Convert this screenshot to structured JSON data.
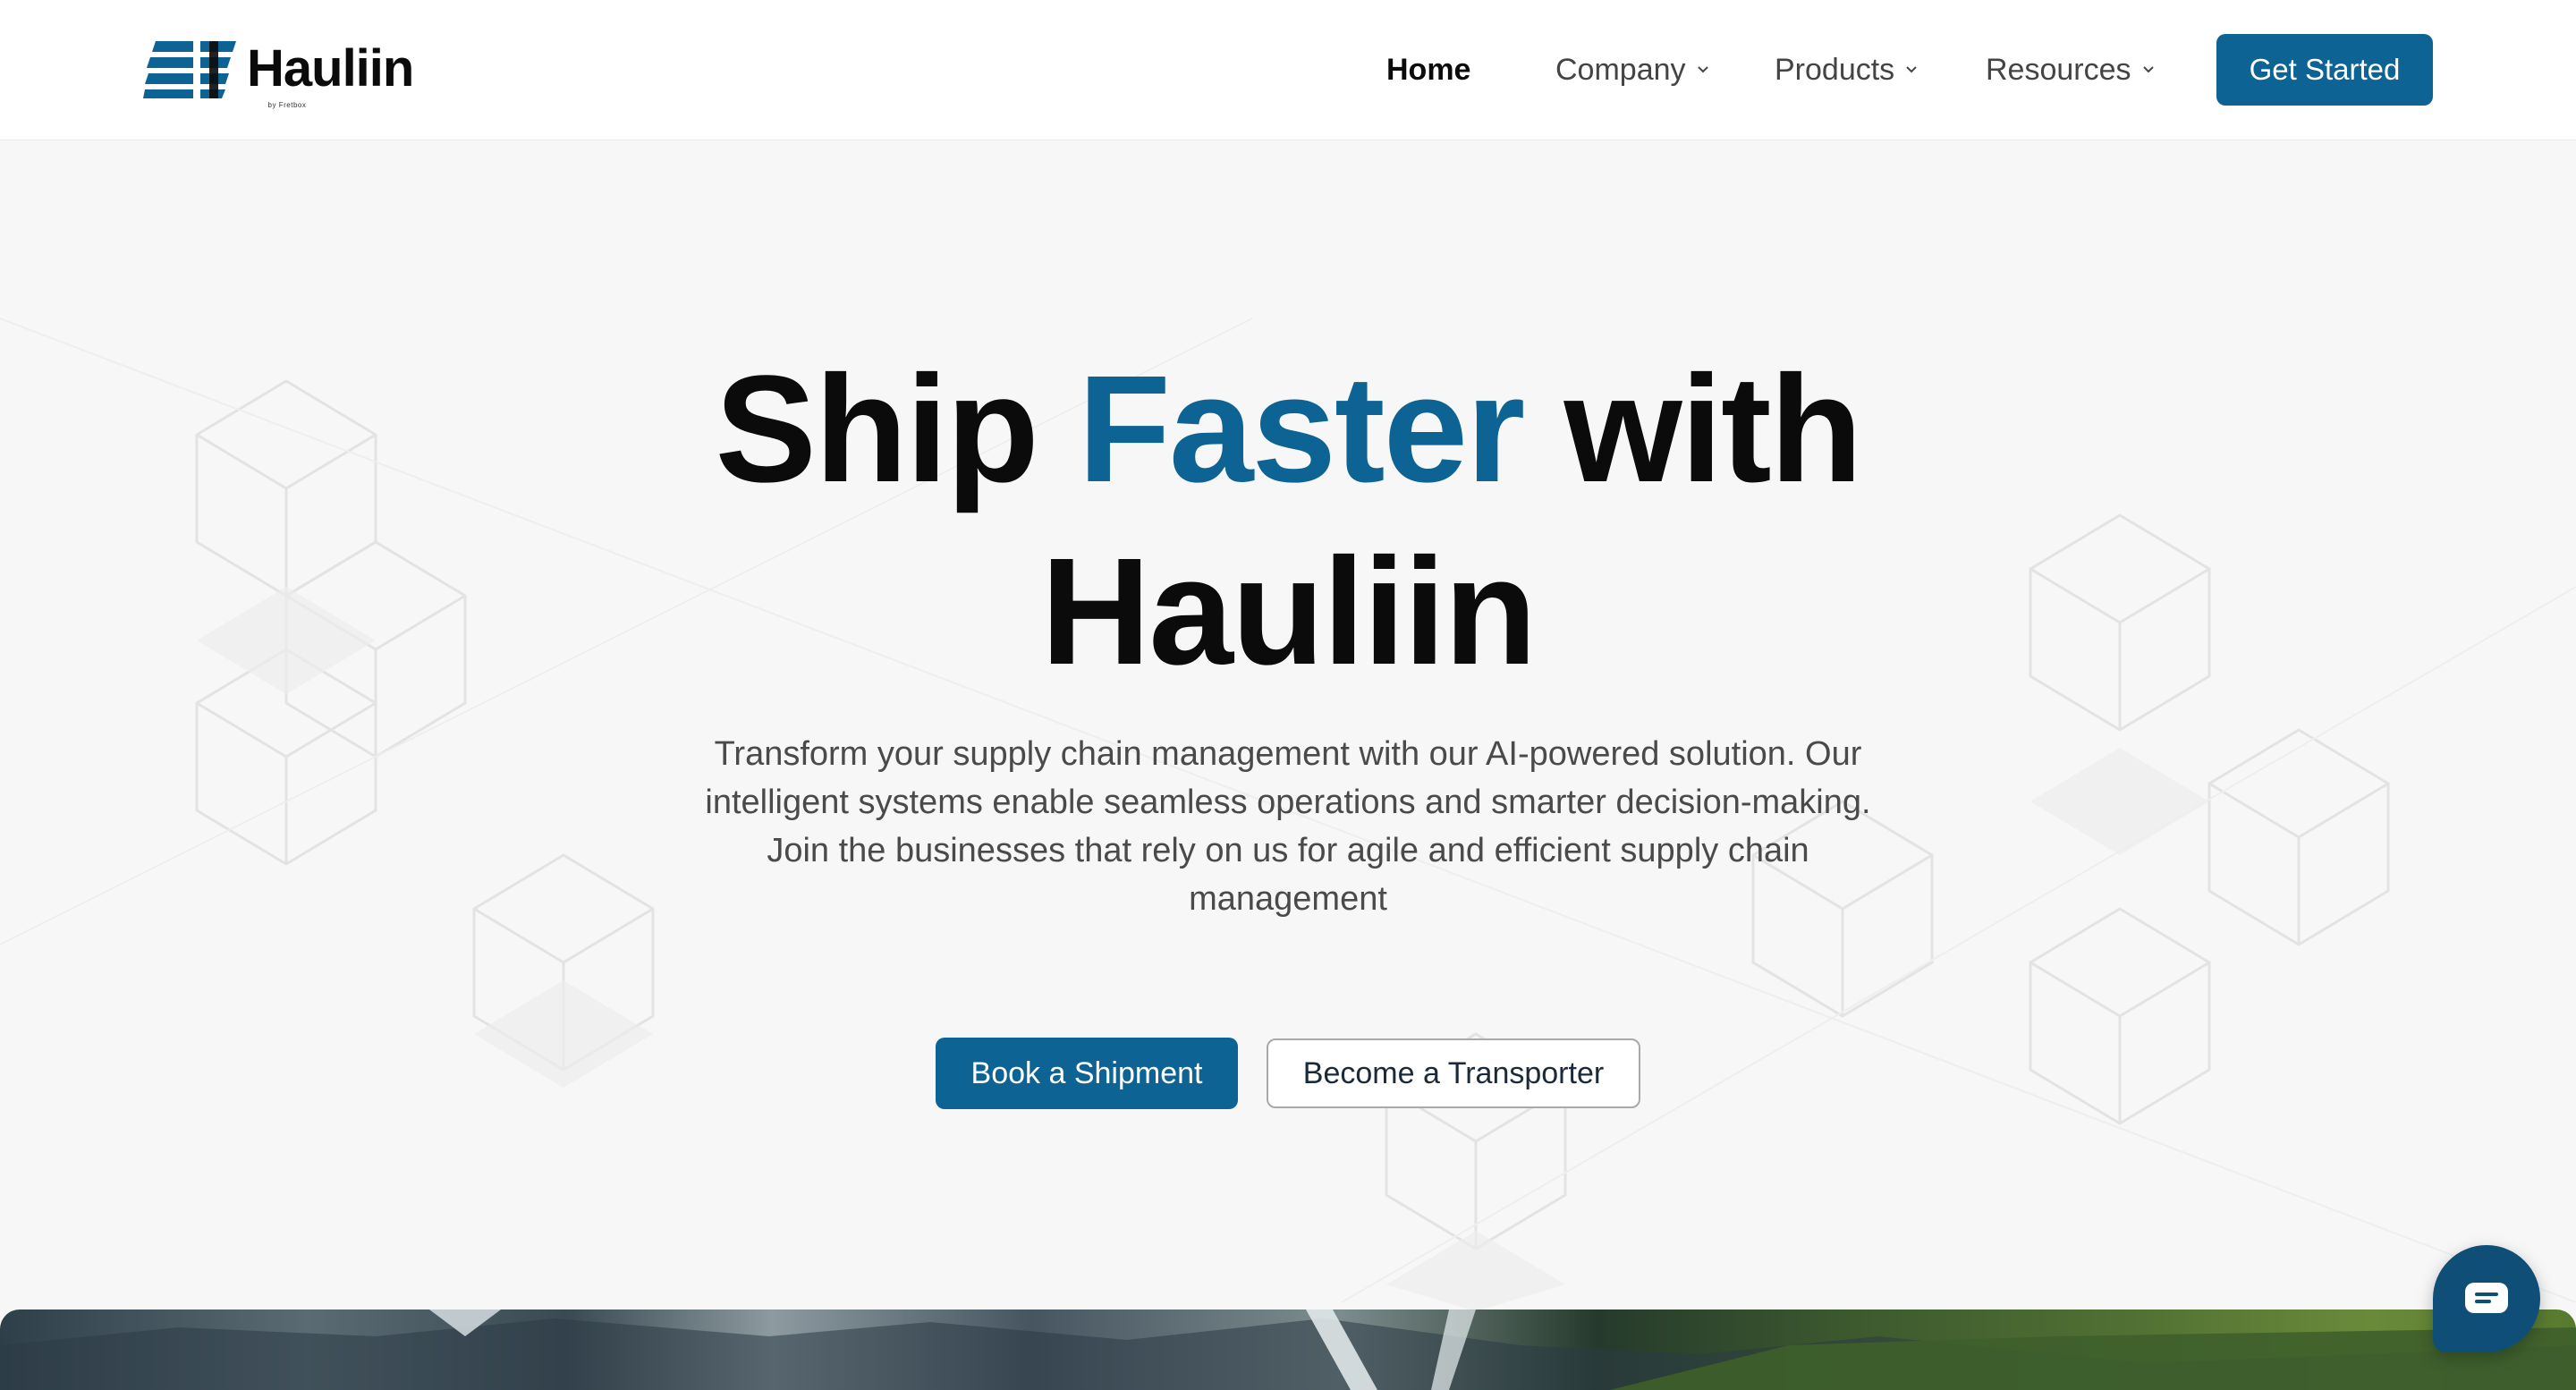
{
  "header": {
    "logo_text": "Hauliin",
    "logo_subtext": "by Fretbox",
    "nav": [
      {
        "label": "Home",
        "active": true
      },
      {
        "label": "Company",
        "has_dropdown": true
      },
      {
        "label": "Products",
        "has_dropdown": true
      },
      {
        "label": "Resources",
        "has_dropdown": true
      }
    ],
    "cta_label": "Get Started"
  },
  "hero": {
    "title_part1": "Ship ",
    "title_accent": "Faster",
    "title_part2": " with",
    "title_line2": "Hauliin",
    "description": "Transform your supply chain management with our AI-powered solution. Our intelligent systems enable seamless operations and smarter decision-making. Join the businesses that rely on us for agile and efficient supply chain management",
    "primary_button": "Book a Shipment",
    "secondary_button": "Become a Transporter"
  },
  "colors": {
    "accent": "#0c6394",
    "chat_bubble": "#0f4f77",
    "background": "#f7f7f7"
  },
  "icons": {
    "chat": "chat-icon",
    "dropdown": "chevron-down-icon",
    "logo": "hauliin-logo-mark"
  }
}
